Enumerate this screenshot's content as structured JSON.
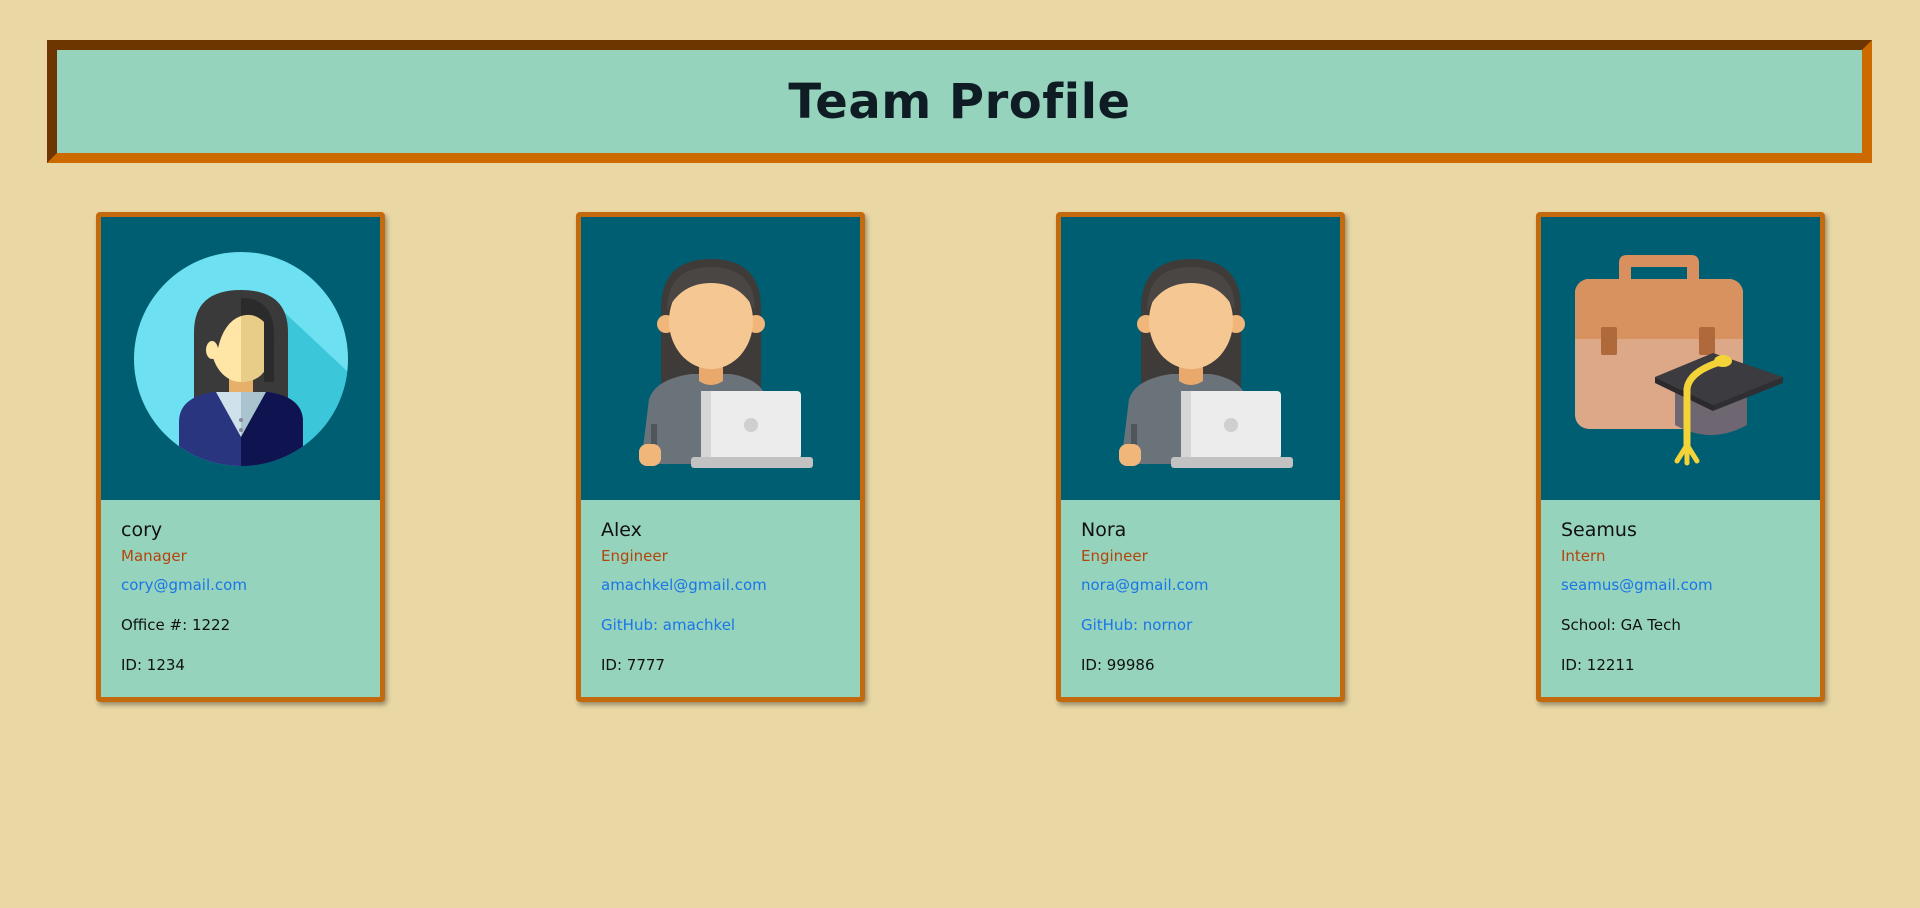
{
  "header": {
    "title": "Team Profile"
  },
  "colors": {
    "background": "#e9d7a4",
    "header_bg": "#95d3bd",
    "header_border": "#cc6a00",
    "card_border": "#c46a0e",
    "card_image_bg": "#005e73",
    "role_text": "#b4440b",
    "link_text": "#1a75e8"
  },
  "cards": [
    {
      "name": "cory",
      "role": "Manager",
      "email": "cory@gmail.com",
      "detail": "Office #: 1222",
      "id": "ID: 1234",
      "icon": "manager-avatar-icon"
    },
    {
      "name": "Alex",
      "role": "Engineer",
      "email": "amachkel@gmail.com",
      "detail": "GitHub: amachkel",
      "id": "ID: 7777",
      "icon": "engineer-avatar-icon"
    },
    {
      "name": "Nora",
      "role": "Engineer",
      "email": "nora@gmail.com",
      "detail": "GitHub: nornor",
      "id": "ID: 99986",
      "icon": "engineer-avatar-icon"
    },
    {
      "name": "Seamus",
      "role": "Intern",
      "email": "seamus@gmail.com",
      "detail": "School: GA Tech",
      "id": "ID: 12211",
      "icon": "intern-briefcase-cap-icon"
    }
  ]
}
